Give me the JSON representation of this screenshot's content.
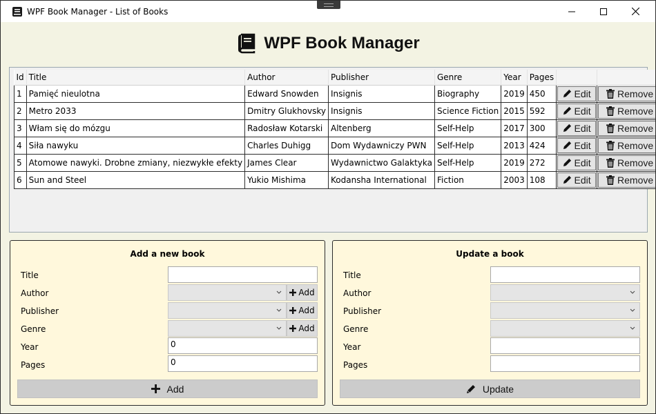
{
  "window": {
    "title": "WPF Book Manager - List of Books"
  },
  "header": {
    "title": "WPF Book Manager",
    "icon": "book-icon"
  },
  "table": {
    "columns": [
      "Id",
      "Title",
      "Author",
      "Publisher",
      "Genre",
      "Year",
      "Pages"
    ],
    "edit_label": "Edit",
    "remove_label": "Remove",
    "rows": [
      {
        "id": "1",
        "title": "Pamięć nieulotna",
        "author": "Edward Snowden",
        "publisher": "Insignis",
        "genre": "Biography",
        "year": "2019",
        "pages": "450"
      },
      {
        "id": "2",
        "title": "Metro 2033",
        "author": "Dmitry Glukhovsky",
        "publisher": "Insignis",
        "genre": "Science Fiction",
        "year": "2015",
        "pages": "592"
      },
      {
        "id": "3",
        "title": "Włam się do mózgu",
        "author": "Radosław Kotarski",
        "publisher": "Altenberg",
        "genre": "Self-Help",
        "year": "2017",
        "pages": "300"
      },
      {
        "id": "4",
        "title": "Siła nawyku",
        "author": "Charles Duhigg",
        "publisher": "Dom Wydawniczy PWN",
        "genre": "Self-Help",
        "year": "2013",
        "pages": "424"
      },
      {
        "id": "5",
        "title": "Atomowe nawyki. Drobne zmiany, niezwykłe efekty",
        "author": "James Clear",
        "publisher": "Wydawnictwo Galaktyka",
        "genre": "Self-Help",
        "year": "2019",
        "pages": "272"
      },
      {
        "id": "6",
        "title": "Sun and Steel",
        "author": "Yukio Mishima",
        "publisher": "Kodansha International",
        "genre": "Fiction",
        "year": "2003",
        "pages": "108"
      }
    ]
  },
  "add_panel": {
    "heading": "Add a new book",
    "labels": {
      "title": "Title",
      "author": "Author",
      "publisher": "Publisher",
      "genre": "Genre",
      "year": "Year",
      "pages": "Pages"
    },
    "values": {
      "title": "",
      "year": "0",
      "pages": "0"
    },
    "mini_add_label": "Add",
    "submit_label": "Add"
  },
  "update_panel": {
    "heading": "Update a book",
    "labels": {
      "title": "Title",
      "author": "Author",
      "publisher": "Publisher",
      "genre": "Genre",
      "year": "Year",
      "pages": "Pages"
    },
    "values": {
      "title": "",
      "year": "",
      "pages": ""
    },
    "submit_label": "Update"
  }
}
